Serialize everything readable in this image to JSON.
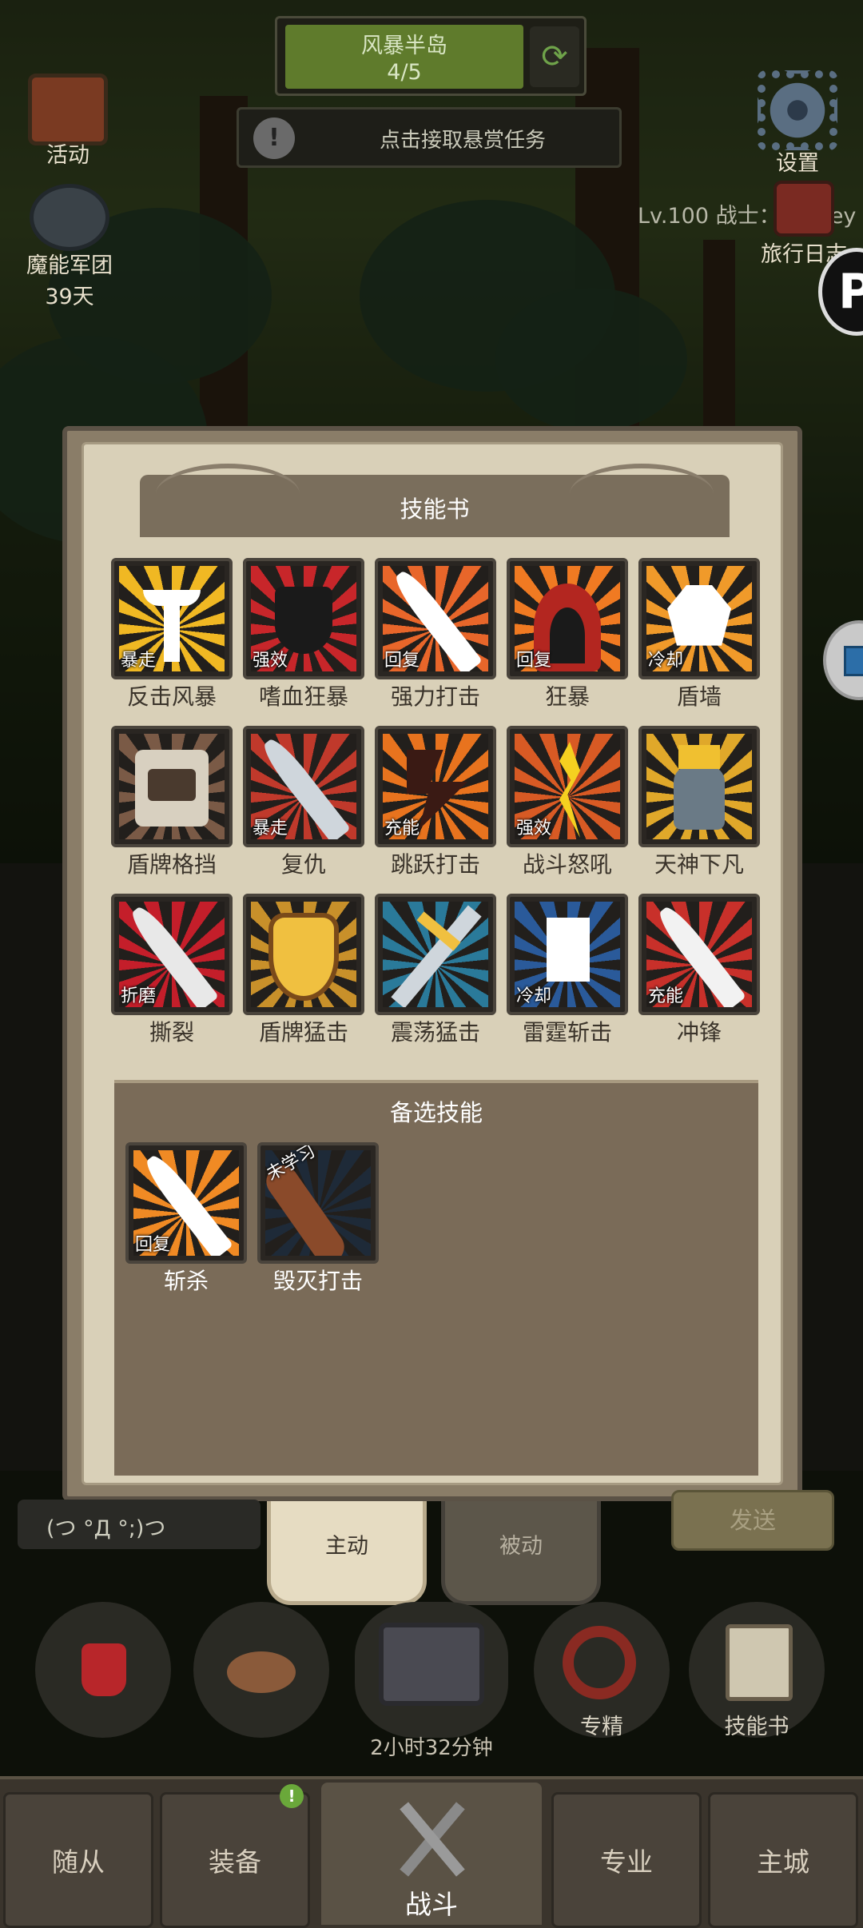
{
  "region": {
    "name": "风暴半岛",
    "progress": "4/5",
    "swap_icon": "swap-icon"
  },
  "bounty": {
    "text": "点击接取悬赏任务",
    "alert": "!"
  },
  "hud": {
    "activity_label": "活动",
    "legion_label": "魔能军团",
    "legion_days": "39天",
    "settings_label": "设置",
    "player": "Lv.100 战士：sLxuey",
    "journal_label": "旅行日志"
  },
  "panel": {
    "title": "技能书",
    "skills": [
      {
        "name": "反击风暴",
        "tag": "暴走",
        "icon": "trident-icon",
        "bg": "#f0b823",
        "fg": "#ffffff"
      },
      {
        "name": "嗜血狂暴",
        "tag": "强效",
        "icon": "blood-mask-icon",
        "bg": "#c8262a",
        "fg": "#1a1a1a"
      },
      {
        "name": "强力打击",
        "tag": "回复",
        "icon": "blade-strike-icon",
        "bg": "#e8662a",
        "fg": "#ffffff"
      },
      {
        "name": "狂暴",
        "tag": "回复",
        "icon": "hooded-rage-icon",
        "bg": "#f07a22",
        "fg": "#b32620"
      },
      {
        "name": "盾墙",
        "tag": "冷却",
        "icon": "shield-wall-icon",
        "bg": "#f09a2a",
        "fg": "#ffffff"
      },
      {
        "name": "盾牌格挡",
        "tag": "",
        "icon": "shield-block-icon",
        "bg": "#7a5a46",
        "fg": "#d8d0c0"
      },
      {
        "name": "复仇",
        "tag": "暴走",
        "icon": "revenge-sword-icon",
        "bg": "#c0392b",
        "fg": "#cfd6dc"
      },
      {
        "name": "跳跃打击",
        "tag": "充能",
        "icon": "leap-strike-icon",
        "bg": "#e8731e",
        "fg": "#3a1a14"
      },
      {
        "name": "战斗怒吼",
        "tag": "强效",
        "icon": "battle-shout-icon",
        "bg": "#d85a24",
        "fg": "#f5d020"
      },
      {
        "name": "天神下凡",
        "tag": "",
        "icon": "avatar-icon",
        "bg": "#e0a82a",
        "fg": "#6a7a86"
      },
      {
        "name": "撕裂",
        "tag": "折磨",
        "icon": "rend-icon",
        "bg": "#c41e2a",
        "fg": "#e8e8e8"
      },
      {
        "name": "盾牌猛击",
        "tag": "",
        "icon": "shield-slam-icon",
        "bg": "#c8902a",
        "fg": "#f0c040"
      },
      {
        "name": "震荡猛击",
        "tag": "",
        "icon": "shockwave-icon",
        "bg": "#2a7a9a",
        "fg": "#f0c040"
      },
      {
        "name": "雷霆斩击",
        "tag": "冷却",
        "icon": "thunder-slash-icon",
        "bg": "#2a5a9a",
        "fg": "#ffffff"
      },
      {
        "name": "冲锋",
        "tag": "充能",
        "icon": "charge-icon",
        "bg": "#c8302a",
        "fg": "#f2f2f2"
      }
    ],
    "alt_title": "备选技能",
    "alt_skills": [
      {
        "name": "斩杀",
        "tag": "回复",
        "icon": "execute-icon",
        "bg": "#f08a24",
        "fg": "#ffffff"
      },
      {
        "name": "毁灭打击",
        "tag": "未学习",
        "icon": "devastate-icon",
        "bg": "#1e2a38",
        "fg": "#8a4a2a"
      }
    ]
  },
  "tabs": {
    "active": "主动",
    "passive": "被动"
  },
  "chat": {
    "text": "(つ °Д °;)つ",
    "send": "发送"
  },
  "actions": {
    "potion_icon": "potion-icon",
    "bread_icon": "bread-icon",
    "chest_icon": "treasure-chest-icon",
    "specialize_label": "专精",
    "skillbook_label": "技能书",
    "timer": "2小时32分钟"
  },
  "nav": {
    "followers": "随从",
    "equipment": "装备",
    "equipment_badge": "!",
    "fight": "战斗",
    "profession": "专业",
    "capital": "主城"
  }
}
